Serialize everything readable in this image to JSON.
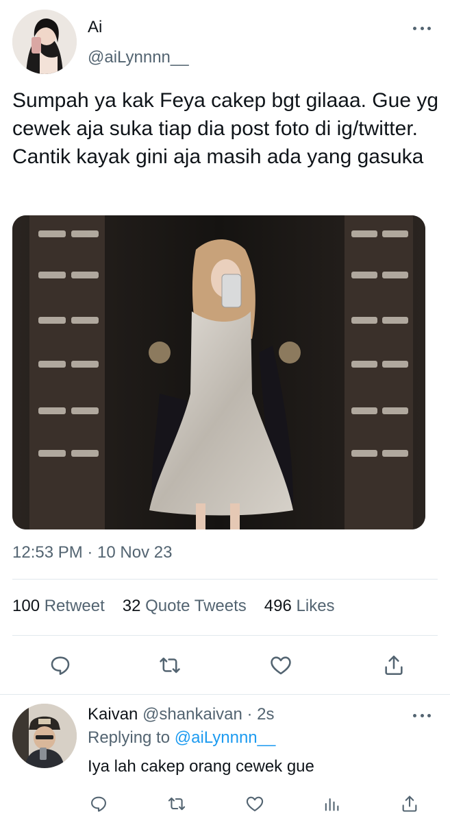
{
  "tweet": {
    "display_name": "Ai",
    "handle": "@aiLynnnn__",
    "text": "Sumpah ya kak Feya cakep bgt gilaaa. Gue yg cewek aja suka tiap dia post foto di ig/twitter. Cantik kayak gini aja masih ada yang gasuka",
    "timestamp": "12:53 PM · 10 Nov 23",
    "stats": {
      "retweets": "100",
      "retweets_label": "Retweet",
      "quotes": "32",
      "quotes_label": "Quote Tweets",
      "likes": "496",
      "likes_label": "Likes"
    },
    "icons": [
      "more-icon",
      "reply-icon",
      "retweet-icon",
      "like-icon",
      "share-icon"
    ]
  },
  "reply": {
    "name": "Kaivan",
    "handle": "@shankaivan",
    "time": "· 2s",
    "replying_prefix": "Replying to",
    "replying_to": "@aiLynnnn__",
    "text": "Iya lah cakep orang cewek gue",
    "icons": [
      "reply-icon",
      "retweet-icon",
      "like-icon",
      "analytics-icon",
      "share-icon"
    ]
  },
  "colors": {
    "text": "#0f1419",
    "secondary": "#536471",
    "accent": "#1d9bf0",
    "divider": "#e1e8ed"
  }
}
